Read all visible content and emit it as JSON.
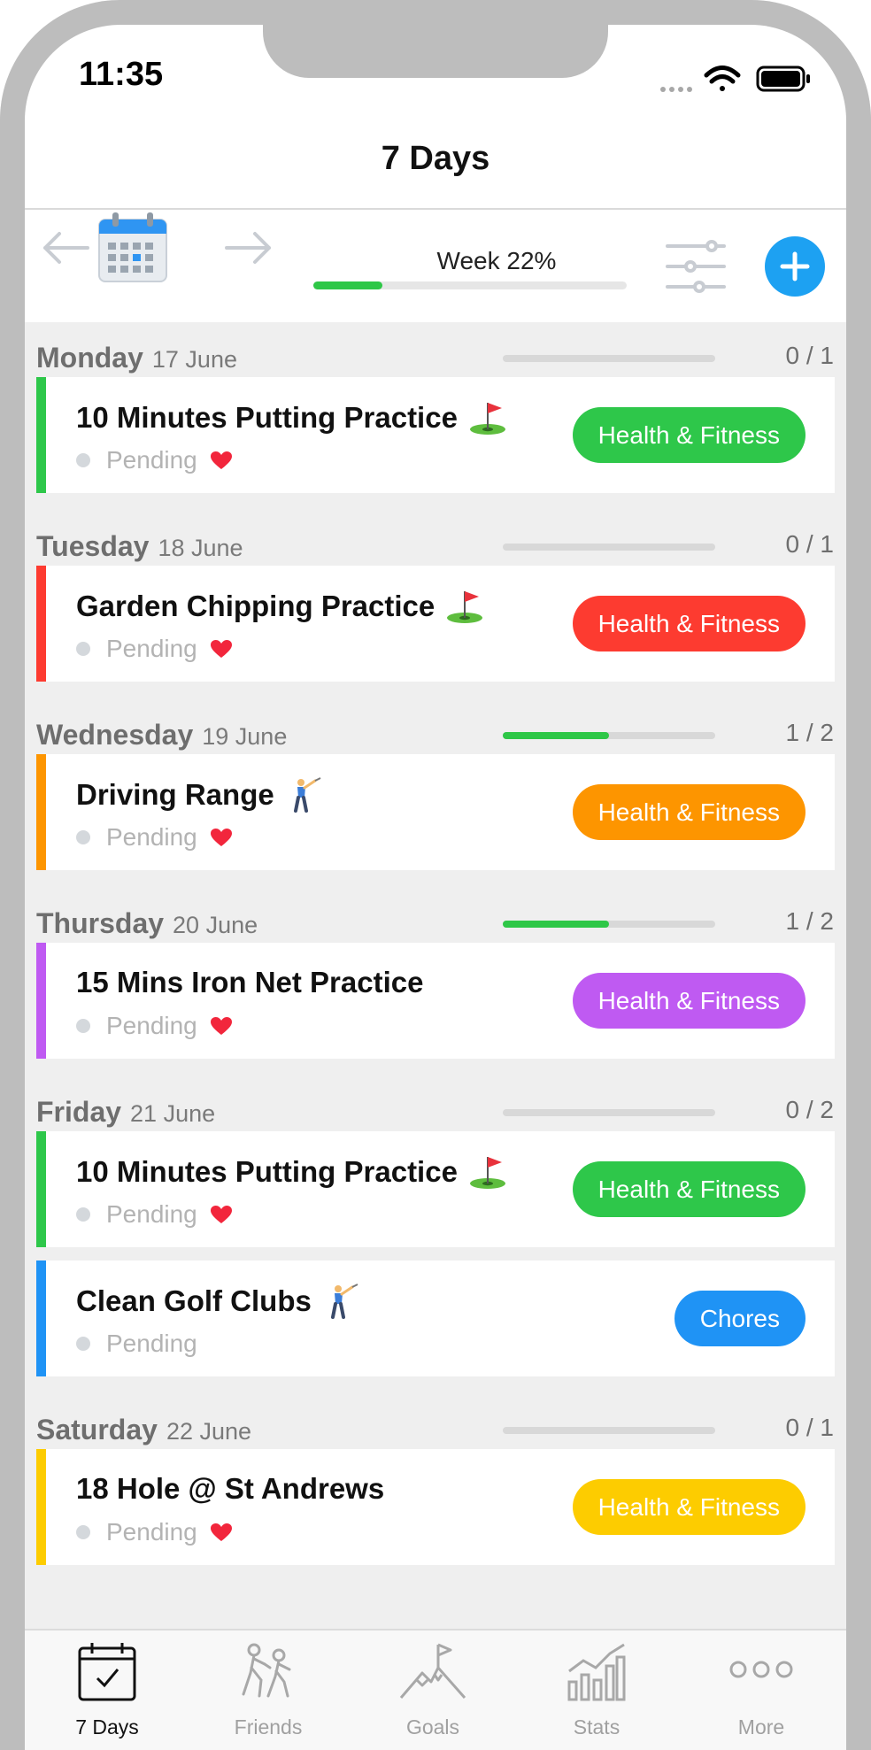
{
  "status_bar": {
    "time": "11:35"
  },
  "nav": {
    "title": "7 Days"
  },
  "toolbar": {
    "week_label": "Week 22%",
    "week_progress": 0.22,
    "icons": [
      "arrow-left-icon",
      "calendar-icon",
      "arrow-right-icon",
      "filter-sliders-icon",
      "add-icon"
    ]
  },
  "colors": {
    "green": "#2ec74a",
    "red": "#fd3b30",
    "orange": "#fd9500",
    "purple": "#bf5af2",
    "blue": "#1f93f5",
    "yellow": "#fdcc00",
    "accent": "#1da1f2"
  },
  "days": [
    {
      "name": "Monday",
      "date": "17 June",
      "count": "0 / 1",
      "progress": 0.0,
      "tasks": [
        {
          "title": "10 Minutes Putting Practice",
          "emoji": "flag-in-hole-icon",
          "status": "Pending",
          "heart": true,
          "tag": "Health & Fitness",
          "color": "#2ec74a"
        }
      ]
    },
    {
      "name": "Tuesday",
      "date": "18 June",
      "count": "0 / 1",
      "progress": 0.0,
      "tasks": [
        {
          "title": "Garden Chipping Practice",
          "emoji": "flag-in-hole-icon",
          "status": "Pending",
          "heart": true,
          "tag": "Health & Fitness",
          "color": "#fd3b30"
        }
      ]
    },
    {
      "name": "Wednesday",
      "date": "19 June",
      "count": "1 / 2",
      "progress": 0.5,
      "tasks": [
        {
          "title": "Driving Range",
          "emoji": "golfer-icon",
          "status": "Pending",
          "heart": true,
          "tag": "Health & Fitness",
          "color": "#fd9500"
        }
      ]
    },
    {
      "name": "Thursday",
      "date": "20 June",
      "count": "1 / 2",
      "progress": 0.5,
      "tasks": [
        {
          "title": "15 Mins Iron Net Practice",
          "emoji": "",
          "status": "Pending",
          "heart": true,
          "tag": "Health & Fitness",
          "color": "#bf5af2"
        }
      ]
    },
    {
      "name": "Friday",
      "date": "21 June",
      "count": "0 / 2",
      "progress": 0.0,
      "tasks": [
        {
          "title": "10 Minutes Putting Practice",
          "emoji": "flag-in-hole-icon",
          "status": "Pending",
          "heart": true,
          "tag": "Health & Fitness",
          "color": "#2ec74a"
        },
        {
          "title": "Clean Golf Clubs",
          "emoji": "golfer-icon",
          "status": "Pending",
          "heart": false,
          "tag": "Chores",
          "color": "#1f93f5"
        }
      ]
    },
    {
      "name": "Saturday",
      "date": "22 June",
      "count": "0 / 1",
      "progress": 0.0,
      "tasks": [
        {
          "title": "18 Hole @ St Andrews",
          "emoji": "",
          "status": "Pending",
          "heart": true,
          "tag": "Health & Fitness",
          "color": "#fdcc00"
        }
      ]
    }
  ],
  "tabbar": {
    "tabs": [
      {
        "label": "7 Days",
        "icon": "calendar-check-icon",
        "active": true
      },
      {
        "label": "Friends",
        "icon": "friends-icon",
        "active": false
      },
      {
        "label": "Goals",
        "icon": "mountain-flag-icon",
        "active": false
      },
      {
        "label": "Stats",
        "icon": "bar-chart-icon",
        "active": false
      },
      {
        "label": "More",
        "icon": "more-dots-icon",
        "active": false
      }
    ]
  }
}
